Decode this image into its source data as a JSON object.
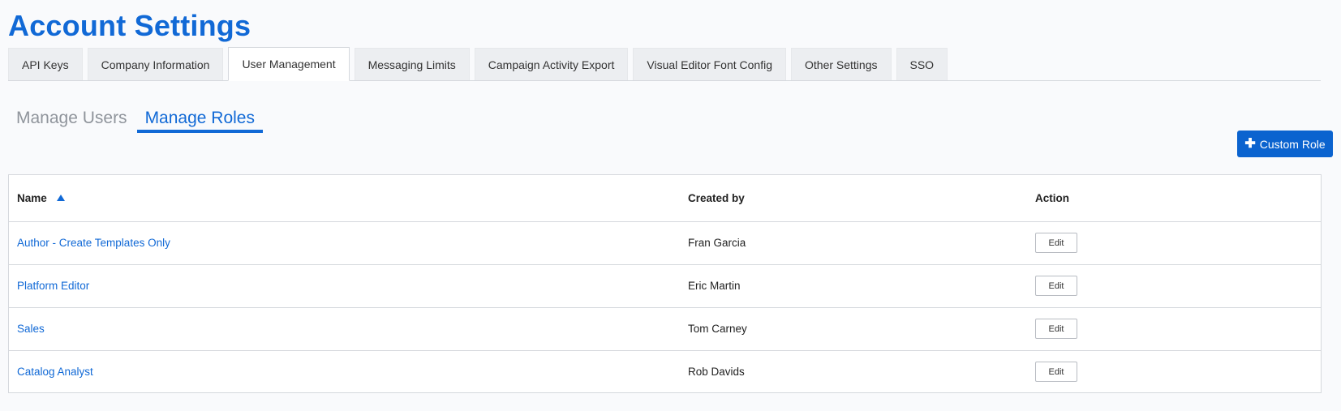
{
  "page": {
    "title": "Account Settings"
  },
  "tabs": [
    {
      "label": "API Keys",
      "active": false
    },
    {
      "label": "Company Information",
      "active": false
    },
    {
      "label": "User Management",
      "active": true
    },
    {
      "label": "Messaging Limits",
      "active": false
    },
    {
      "label": "Campaign Activity Export",
      "active": false
    },
    {
      "label": "Visual Editor Font Config",
      "active": false
    },
    {
      "label": "Other Settings",
      "active": false
    },
    {
      "label": "SSO",
      "active": false
    }
  ],
  "subtabs": [
    {
      "label": "Manage Users",
      "active": false
    },
    {
      "label": "Manage Roles",
      "active": true
    }
  ],
  "actions": {
    "custom_role_label": "Custom Role",
    "custom_role_icon": "plus-icon"
  },
  "table": {
    "columns": {
      "name": "Name",
      "created_by": "Created by",
      "action": "Action"
    },
    "sort": {
      "column": "name",
      "direction": "ascending",
      "icon": "sort-ascending-icon"
    },
    "rows": [
      {
        "name": "Author - Create Templates Only",
        "created_by": "Fran Garcia",
        "action": "Edit"
      },
      {
        "name": "Platform Editor",
        "created_by": "Eric Martin",
        "action": "Edit"
      },
      {
        "name": "Sales",
        "created_by": "Tom Carney",
        "action": "Edit"
      },
      {
        "name": "Catalog Analyst",
        "created_by": "Rob Davids",
        "action": "Edit"
      }
    ]
  },
  "colors": {
    "accent": "#1169d6",
    "button_primary": "#0b63cf",
    "background": "#f9fafc",
    "border": "#d5d8dd"
  }
}
